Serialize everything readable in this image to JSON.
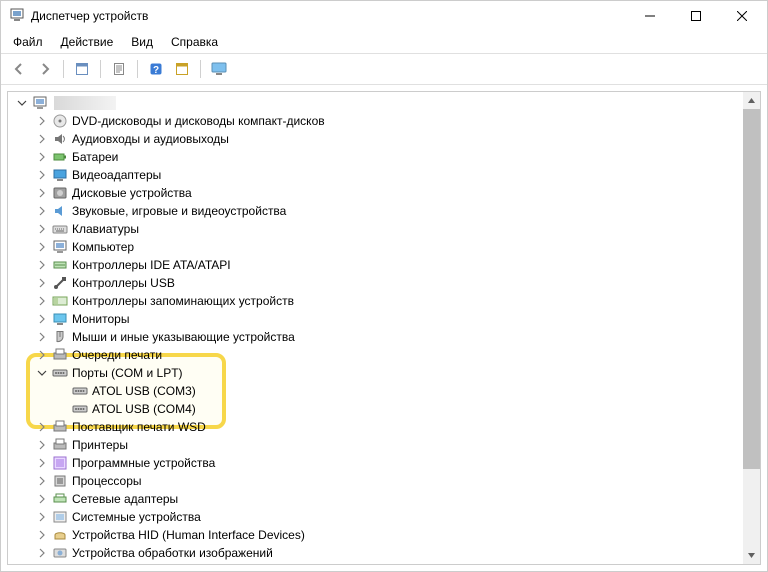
{
  "window": {
    "title": "Диспетчер устройств"
  },
  "menu": [
    "Файл",
    "Действие",
    "Вид",
    "Справка"
  ],
  "toolbar": {
    "back": "back",
    "forward": "forward",
    "show_hidden": "show-hidden",
    "properties": "properties",
    "help": "help",
    "refresh": "refresh",
    "views": "views"
  },
  "tree": {
    "root_expanded": true,
    "categories": [
      {
        "key": "dvd",
        "label": "DVD-дисководы и дисководы компакт-дисков",
        "expanded": false
      },
      {
        "key": "audio",
        "label": "Аудиовходы и аудиовыходы",
        "expanded": false
      },
      {
        "key": "battery",
        "label": "Батареи",
        "expanded": false
      },
      {
        "key": "display",
        "label": "Видеоадаптеры",
        "expanded": false
      },
      {
        "key": "disk",
        "label": "Дисковые устройства",
        "expanded": false
      },
      {
        "key": "sound",
        "label": "Звуковые, игровые и видеоустройства",
        "expanded": false
      },
      {
        "key": "keyboard",
        "label": "Клавиатуры",
        "expanded": false
      },
      {
        "key": "computer",
        "label": "Компьютер",
        "expanded": false
      },
      {
        "key": "ide",
        "label": "Контроллеры IDE ATA/ATAPI",
        "expanded": false
      },
      {
        "key": "usb",
        "label": "Контроллеры USB",
        "expanded": false
      },
      {
        "key": "storage",
        "label": "Контроллеры запоминающих устройств",
        "expanded": false
      },
      {
        "key": "monitor",
        "label": "Мониторы",
        "expanded": false
      },
      {
        "key": "mouse",
        "label": "Мыши и иные указывающие устройства",
        "expanded": false
      },
      {
        "key": "printq",
        "label": "Очереди печати",
        "expanded": false
      },
      {
        "key": "ports",
        "label": "Порты (COM и LPT)",
        "expanded": true,
        "children": [
          {
            "key": "atol_com3",
            "label": "ATOL USB (COM3)"
          },
          {
            "key": "atol_com4",
            "label": "ATOL USB (COM4)"
          }
        ]
      },
      {
        "key": "wsdprint",
        "label": "Поставщик печати WSD",
        "expanded": false
      },
      {
        "key": "printer",
        "label": "Принтеры",
        "expanded": false
      },
      {
        "key": "software",
        "label": "Программные устройства",
        "expanded": false
      },
      {
        "key": "cpu",
        "label": "Процессоры",
        "expanded": false
      },
      {
        "key": "net",
        "label": "Сетевые адаптеры",
        "expanded": false
      },
      {
        "key": "system",
        "label": "Системные устройства",
        "expanded": false
      },
      {
        "key": "hid",
        "label": "Устройства HID (Human Interface Devices)",
        "expanded": false
      },
      {
        "key": "imaging",
        "label": "Устройства обработки изображений",
        "expanded": false
      }
    ]
  }
}
